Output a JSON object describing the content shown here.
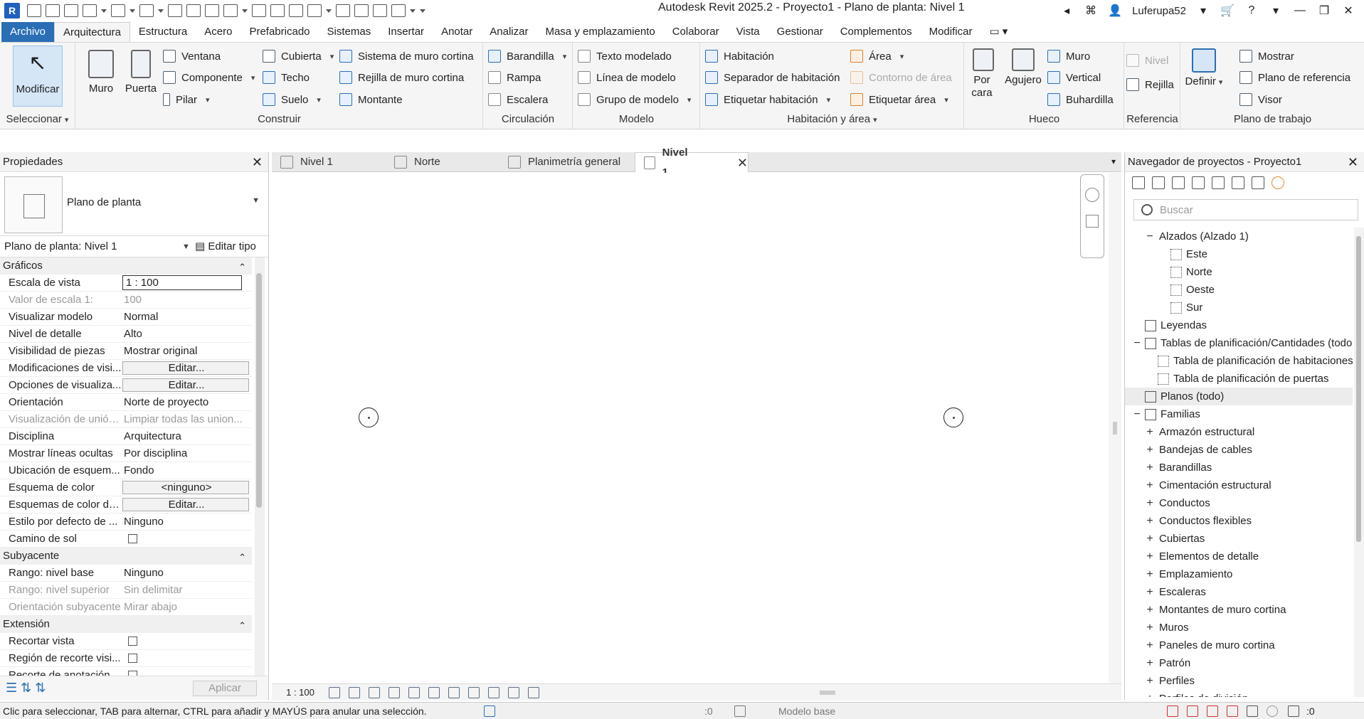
{
  "title": {
    "app_title": "Autodesk Revit 2025.2 - Proyecto1 - Plano de planta: Nivel 1",
    "logo": "R",
    "user": "Luferupa52"
  },
  "tabs": [
    "Archivo",
    "Arquitectura",
    "Estructura",
    "Acero",
    "Prefabricado",
    "Sistemas",
    "Insertar",
    "Anotar",
    "Analizar",
    "Masa y emplazamiento",
    "Colaborar",
    "Vista",
    "Gestionar",
    "Complementos",
    "Modificar"
  ],
  "ribbon": {
    "seleccionar": {
      "modify": "Modificar",
      "title": "Seleccionar"
    },
    "construir": {
      "muro": "Muro",
      "puerta": "Puerta",
      "ventana": "Ventana",
      "componente": "Componente",
      "pilar": "Pilar",
      "cubierta": "Cubierta",
      "techo": "Techo",
      "suelo": "Suelo",
      "sistema_muro": "Sistema de muro cortina",
      "rejilla_muro": "Rejilla de muro cortina",
      "montante": "Montante",
      "title": "Construir"
    },
    "circulacion": {
      "barandilla": "Barandilla",
      "rampa": "Rampa",
      "escalera": "Escalera",
      "title": "Circulación"
    },
    "modelo": {
      "texto": "Texto modelado",
      "linea": "Línea de modelo",
      "grupo": "Grupo de modelo",
      "title": "Modelo"
    },
    "habitacion": {
      "habitacion": "Habitación",
      "separador": "Separador de habitación",
      "etiquetar_hab": "Etiquetar habitación",
      "area": "Área",
      "contorno": "Contorno de área",
      "etiquetar_area": "Etiquetar área",
      "title": "Habitación y área"
    },
    "hueco": {
      "por_cara": "Por cara",
      "agujero": "Agujero",
      "muro": "Muro",
      "vertical": "Vertical",
      "buhardilla": "Buhardilla",
      "title": "Hueco"
    },
    "referencia": {
      "nivel": "Nivel",
      "rejilla": "Rejilla",
      "title": "Referencia"
    },
    "trabajo": {
      "definir": "Definir",
      "mostrar": "Mostrar",
      "plano_ref": "Plano de referencia",
      "visor": "Visor",
      "title": "Plano de trabajo"
    }
  },
  "properties": {
    "title": "Propiedades",
    "type_name": "Plano de planta",
    "instance": "Plano de planta: Nivel 1",
    "edit_type": "Editar tipo",
    "groups": [
      {
        "name": "Gráficos",
        "rows": [
          {
            "k": "Escala de vista",
            "v": "1 : 100",
            "kind": "input"
          },
          {
            "k": "Valor de escala    1:",
            "v": "100",
            "kind": "dis"
          },
          {
            "k": "Visualizar modelo",
            "v": "Normal"
          },
          {
            "k": "Nivel de detalle",
            "v": "Alto"
          },
          {
            "k": "Visibilidad de piezas",
            "v": "Mostrar original"
          },
          {
            "k": "Modificaciones de visi...",
            "v": "Editar...",
            "kind": "btn"
          },
          {
            "k": "Opciones de visualiza...",
            "v": "Editar...",
            "kind": "btn"
          },
          {
            "k": "Orientación",
            "v": "Norte de proyecto"
          },
          {
            "k": "Visualización de unión...",
            "v": "Limpiar todas las union...",
            "kind": "dis"
          },
          {
            "k": "Disciplina",
            "v": "Arquitectura"
          },
          {
            "k": "Mostrar líneas ocultas",
            "v": "Por disciplina"
          },
          {
            "k": "Ubicación de esquem...",
            "v": "Fondo"
          },
          {
            "k": "Esquema de color",
            "v": "<ninguno>",
            "kind": "btn"
          },
          {
            "k": "Esquemas de color de...",
            "v": "Editar...",
            "kind": "btn"
          },
          {
            "k": "Estilo por defecto de ...",
            "v": "Ninguno"
          },
          {
            "k": "Camino de sol",
            "v": "",
            "kind": "cb"
          }
        ]
      },
      {
        "name": "Subyacente",
        "rows": [
          {
            "k": "Rango: nivel base",
            "v": "Ninguno"
          },
          {
            "k": "Rango: nivel superior",
            "v": "Sin delimitar",
            "kind": "dis"
          },
          {
            "k": "Orientación subyacente",
            "v": "Mirar abajo",
            "kind": "dis"
          }
        ]
      },
      {
        "name": "Extensión",
        "rows": [
          {
            "k": "Recortar vista",
            "v": "",
            "kind": "cb"
          },
          {
            "k": "Región de recorte visi...",
            "v": "",
            "kind": "cb"
          },
          {
            "k": "Recorte de anotación",
            "v": "",
            "kind": "cb"
          }
        ]
      }
    ],
    "apply": "Aplicar"
  },
  "view_tabs": [
    {
      "label": "Nivel 1",
      "active": false
    },
    {
      "label": "Norte",
      "active": false
    },
    {
      "label": "Planimetría general",
      "active": false
    },
    {
      "label": "Nivel 1",
      "active": true
    }
  ],
  "view_scale": "1 : 100",
  "browser": {
    "title": "Navegador de proyectos - Proyecto1",
    "search_placeholder": "Buscar",
    "nodes": [
      {
        "t": "Alzados (Alzado 1)",
        "lvl": 1,
        "tog": "−",
        "icon": false
      },
      {
        "t": "Este",
        "lvl": 2,
        "icon": true
      },
      {
        "t": "Norte",
        "lvl": 2,
        "icon": true
      },
      {
        "t": "Oeste",
        "lvl": 2,
        "icon": true
      },
      {
        "t": "Sur",
        "lvl": 2,
        "icon": true
      },
      {
        "t": "Leyendas",
        "lvl": 0,
        "icon": true,
        "solid": true
      },
      {
        "t": "Tablas de planificación/Cantidades (todo)",
        "lvl": 0,
        "tog": "−",
        "icon": true,
        "solid": true
      },
      {
        "t": "Tabla de planificación de habitaciones",
        "lvl": 1,
        "icon": true
      },
      {
        "t": "Tabla de planificación de puertas",
        "lvl": 1,
        "icon": true
      },
      {
        "t": "Planos (todo)",
        "lvl": 0,
        "icon": true,
        "solid": true,
        "hl": true
      },
      {
        "t": "Familias",
        "lvl": 0,
        "tog": "−",
        "icon": true,
        "solid": true
      },
      {
        "t": "Armazón estructural",
        "lvl": 1,
        "tog": "+"
      },
      {
        "t": "Bandejas de cables",
        "lvl": 1,
        "tog": "+"
      },
      {
        "t": "Barandillas",
        "lvl": 1,
        "tog": "+"
      },
      {
        "t": "Cimentación estructural",
        "lvl": 1,
        "tog": "+"
      },
      {
        "t": "Conductos",
        "lvl": 1,
        "tog": "+"
      },
      {
        "t": "Conductos flexibles",
        "lvl": 1,
        "tog": "+"
      },
      {
        "t": "Cubiertas",
        "lvl": 1,
        "tog": "+"
      },
      {
        "t": "Elementos de detalle",
        "lvl": 1,
        "tog": "+"
      },
      {
        "t": "Emplazamiento",
        "lvl": 1,
        "tog": "+"
      },
      {
        "t": "Escaleras",
        "lvl": 1,
        "tog": "+"
      },
      {
        "t": "Montantes de muro cortina",
        "lvl": 1,
        "tog": "+"
      },
      {
        "t": "Muros",
        "lvl": 1,
        "tog": "+"
      },
      {
        "t": "Paneles de muro cortina",
        "lvl": 1,
        "tog": "+"
      },
      {
        "t": "Patrón",
        "lvl": 1,
        "tog": "+"
      },
      {
        "t": "Perfiles",
        "lvl": 1,
        "tog": "+"
      },
      {
        "t": "Perfiles de división",
        "lvl": 1,
        "tog": "+"
      }
    ]
  },
  "status": {
    "message": "Clic para seleccionar, TAB para alternar, CTRL para añadir y MAYÚS para anular una selección.",
    "zero": ":0",
    "model": "Modelo base",
    "filter": ":0"
  }
}
